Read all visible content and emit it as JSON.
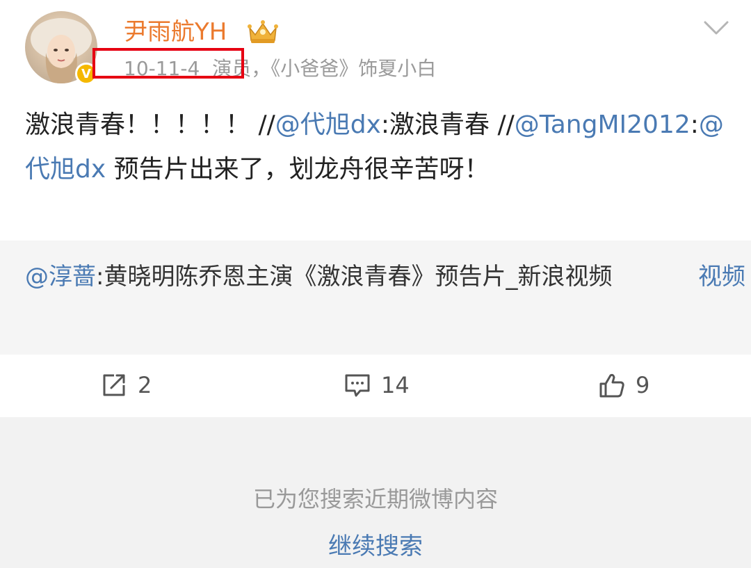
{
  "post": {
    "username": "尹雨航YH",
    "date": "10-11-4",
    "bio": "演员，《小爸爸》饰夏小白",
    "verified_badge": "V",
    "text_plain_1": "激浪青春！！！！！  //",
    "mention_1": "@代旭dx",
    "text_plain_2": ":激浪青春 //",
    "mention_2": "@TangMI2012",
    "text_plain_3": ":",
    "mention_3": "@代旭dx",
    "text_plain_4": " 预告片出来了，划龙舟很辛苦呀！"
  },
  "link_card": {
    "mention": "@淳蔷",
    "text": ":黄晓明陈乔恩主演《激浪青春》预告片_新浪视频",
    "video_label": "视频"
  },
  "actions": {
    "repost_count": "2",
    "comment_count": "14",
    "like_count": "9"
  },
  "footer": {
    "message": "已为您搜索近期微博内容",
    "continue_label": "继续搜索"
  },
  "colors": {
    "username": "#eb7a2e",
    "link": "#4a7ab3",
    "highlight_box": "#e60012",
    "verified": "#f5b800"
  },
  "icons": {
    "repost": "repost-icon",
    "comment": "comment-icon",
    "like": "thumbs-up-icon",
    "crown": "crown-icon",
    "menu": "chevron-down-icon"
  }
}
